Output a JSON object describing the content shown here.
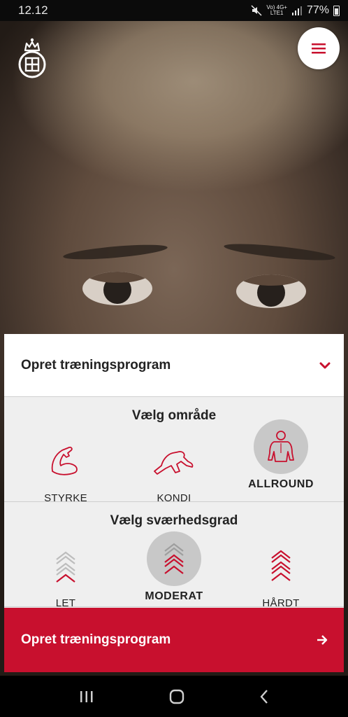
{
  "status": {
    "time": "12.12",
    "network_top": "Vo) 4G+",
    "network_bottom": "LTE1",
    "battery": "77%"
  },
  "header": {
    "title": "Opret træningsprogram"
  },
  "area": {
    "title": "Vælg område",
    "options": [
      {
        "label": "STYRKE",
        "icon": "flexed-arm-icon",
        "selected": false
      },
      {
        "label": "KONDI",
        "icon": "running-legs-icon",
        "selected": false
      },
      {
        "label": "ALLROUND",
        "icon": "body-torso-icon",
        "selected": true
      }
    ]
  },
  "difficulty": {
    "title": "Vælg sværhedsgrad",
    "options": [
      {
        "label": "LET",
        "level": 1,
        "selected": false
      },
      {
        "label": "MODERAT",
        "level": 2,
        "selected": true
      },
      {
        "label": "HÅRDT",
        "level": 3,
        "selected": false
      }
    ]
  },
  "cta": {
    "label": "Opret træningsprogram"
  },
  "colors": {
    "accent": "#c8102e",
    "panel": "#efefef",
    "selected_circle": "#c8c8c8"
  }
}
